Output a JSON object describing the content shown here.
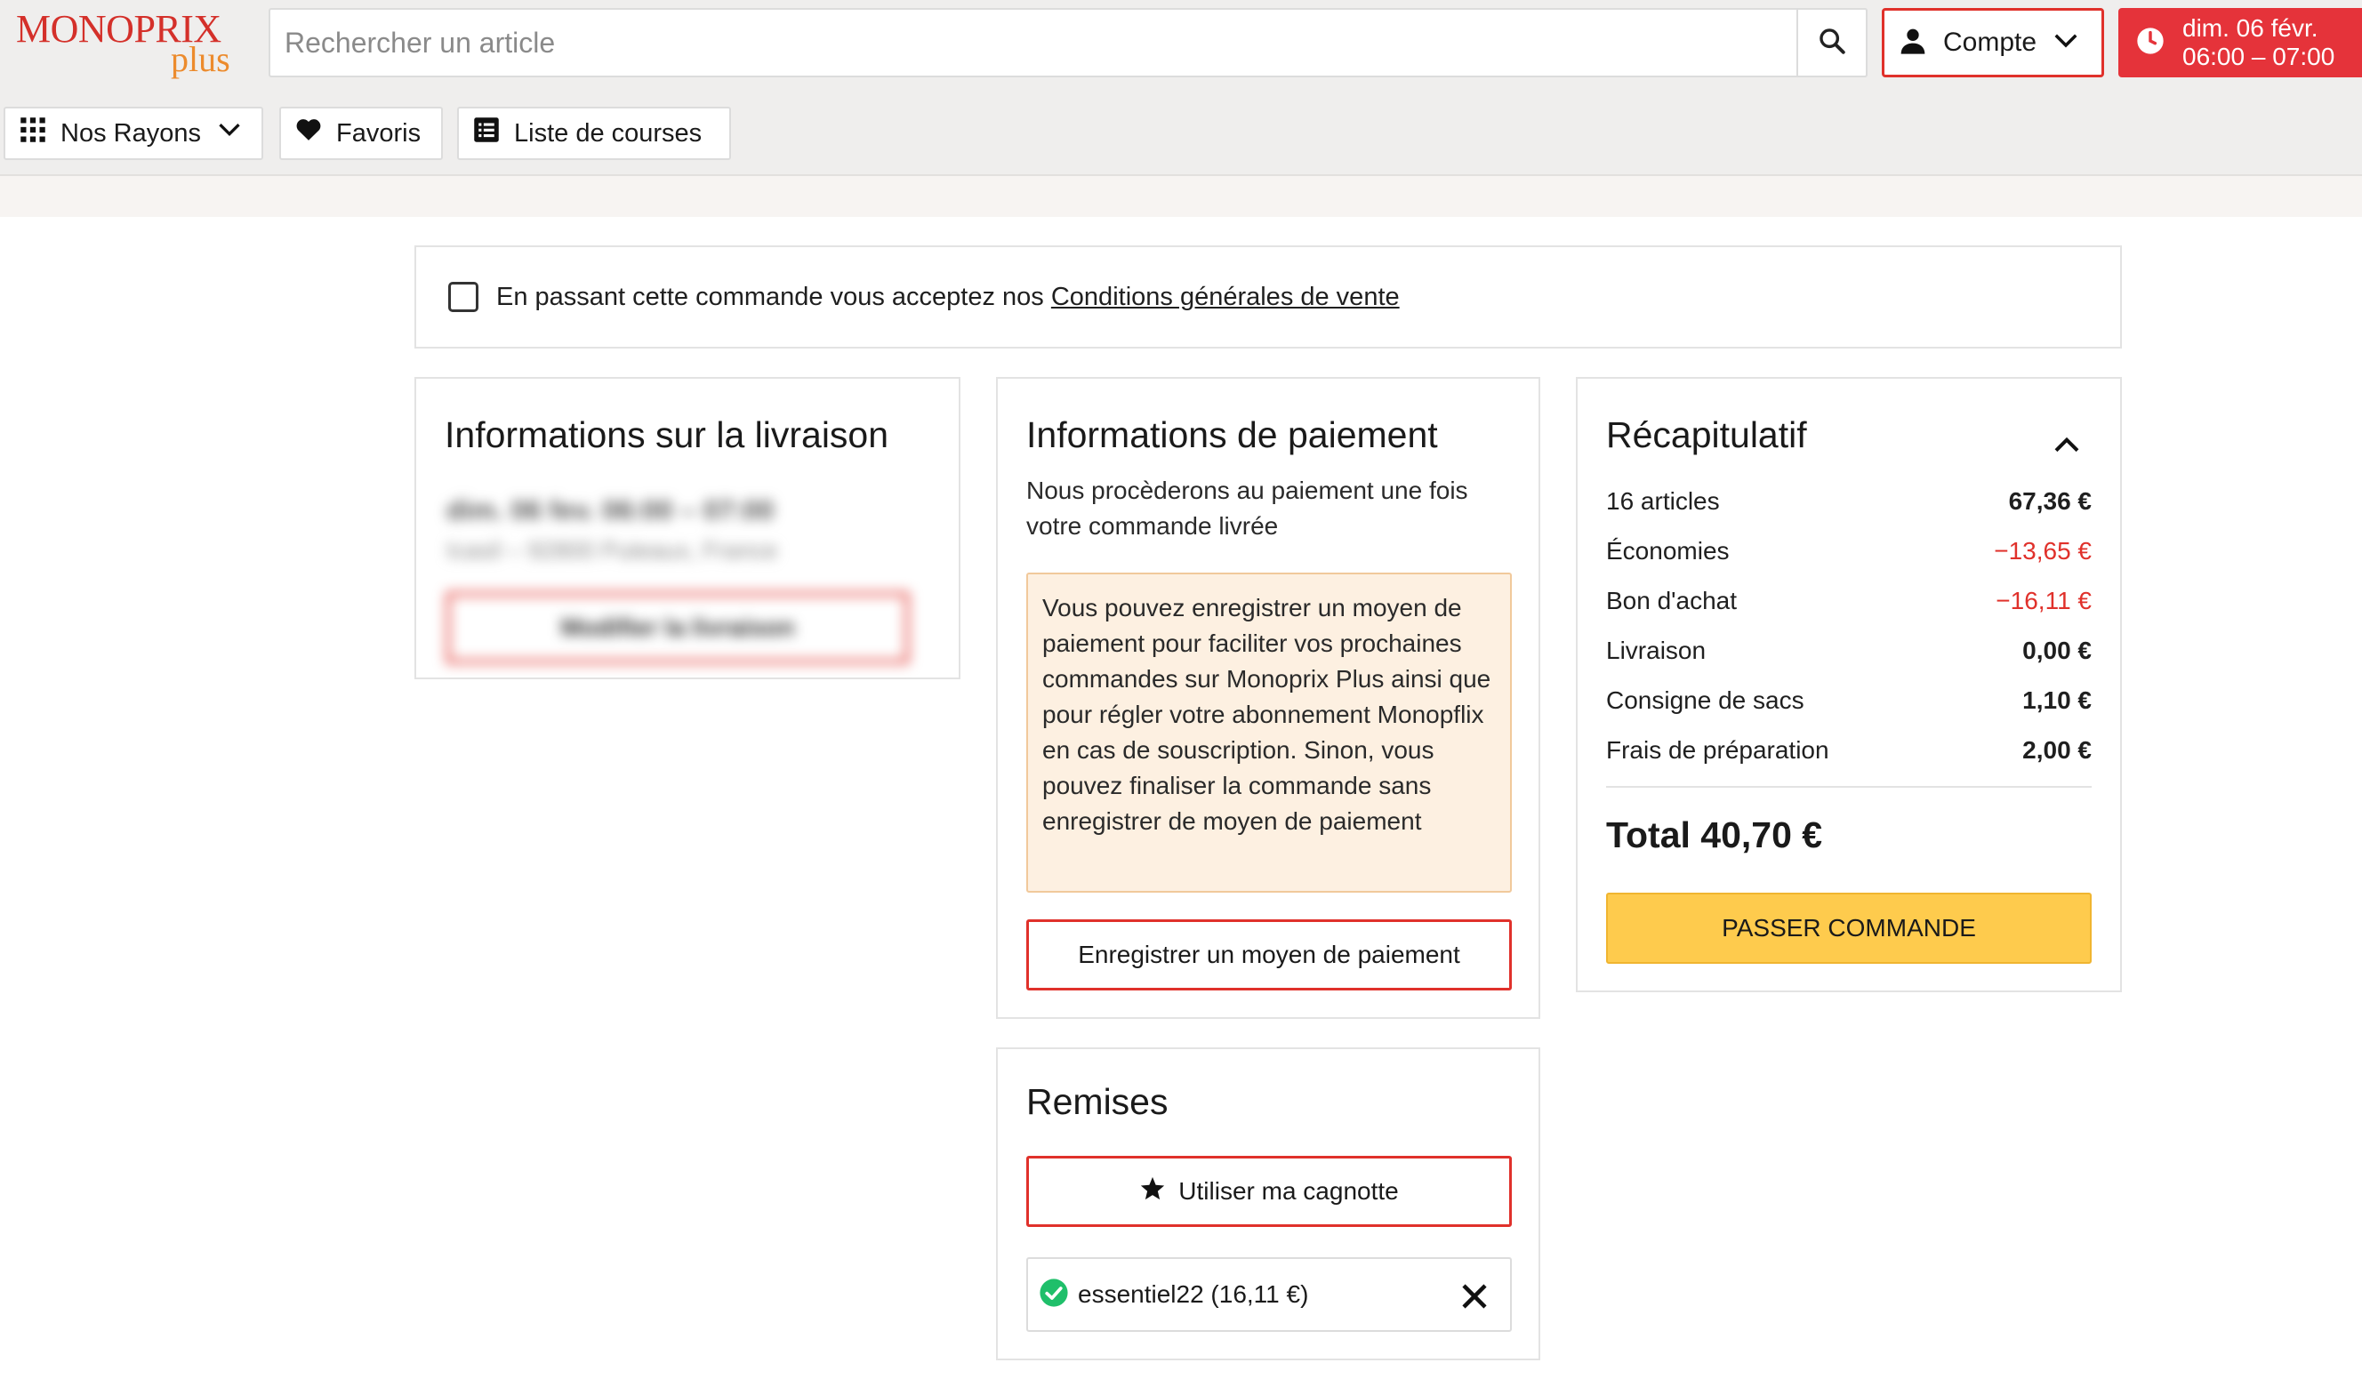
{
  "header": {
    "logo_main": "MONOPRIX",
    "logo_sub": "plus",
    "search_placeholder": "Rechercher un article",
    "account_label": "Compte",
    "slot_line1": "dim. 06 févr.",
    "slot_line2": "06:00 – 07:00",
    "icons": [
      "search-icon",
      "user-icon",
      "chevron-down-icon",
      "clock-icon"
    ]
  },
  "nav": {
    "rayons": "Nos Rayons",
    "favoris": "Favoris",
    "liste": "Liste de courses",
    "icons": [
      "grid-icon",
      "heart-icon",
      "list-icon"
    ]
  },
  "cgv": {
    "text": "En passant cette commande vous acceptez nos ",
    "link": "Conditions générales de vente",
    "checked": false
  },
  "livraison": {
    "title": "Informations sur la livraison",
    "blurred_line1": "dim. 06 fev. 06:00 – 07:00",
    "blurred_line2": "Icasil – 92800 Puteaux, France",
    "blurred_button": "Modifier la livraison"
  },
  "paiement": {
    "title": "Informations de paiement",
    "description": "Nous procèderons au paiement une fois votre commande livrée",
    "note": "Vous pouvez enregistrer un moyen de paiement pour faciliter vos prochaines commandes sur Monoprix Plus ainsi que pour régler votre abonnement Monopflix en cas de souscription. Sinon, vous pouvez finaliser la commande sans enregistrer de moyen de paiement",
    "button": "Enregistrer un moyen de paiement"
  },
  "remises": {
    "title": "Remises",
    "cagnotte_button": "Utiliser ma cagnotte",
    "coupon": "essentiel22 (16,11 €)"
  },
  "recap": {
    "title": "Récapitulatif",
    "rows": [
      {
        "label": "16 articles",
        "value": "67,36 €"
      },
      {
        "label": "Économies",
        "value": "−13,65 €"
      },
      {
        "label": "Bon d'achat",
        "value": "−16,11 €"
      },
      {
        "label": "Livraison",
        "value": "0,00 €"
      },
      {
        "label": "Consigne de sacs",
        "value": "1,10 €"
      },
      {
        "label": "Frais de préparation",
        "value": "2,00 €"
      }
    ],
    "total": "Total 40,70 €",
    "order_button": "PASSER COMMANDE"
  },
  "colors": {
    "brand_red": "#e0312b",
    "slot_red": "#e5333a",
    "order_yellow": "#fecb4d",
    "note_bg": "#fdf0e1",
    "success_green": "#1fbf6a"
  }
}
